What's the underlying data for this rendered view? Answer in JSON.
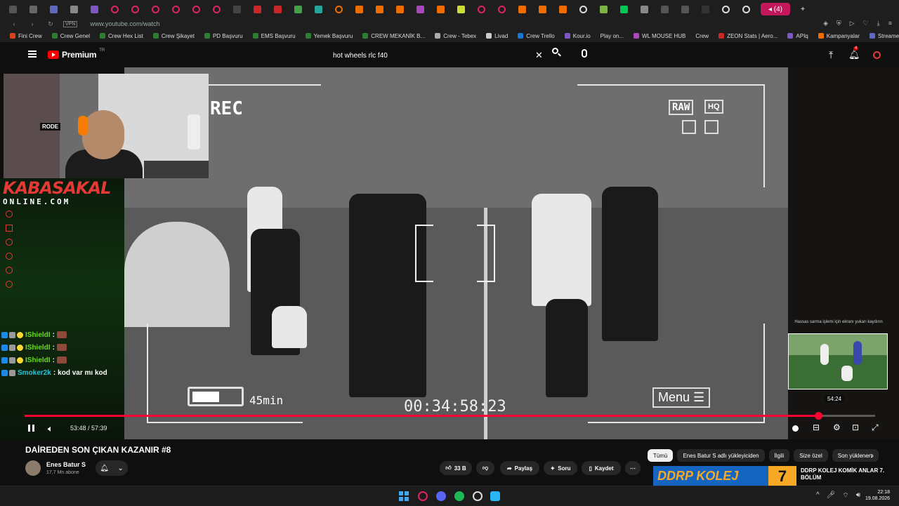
{
  "browser": {
    "active_tab_label": "◂ (4)",
    "url": "www.youtube.com/watch",
    "vpn_label": "VPN"
  },
  "bookmarks": [
    {
      "label": "Fini Crew"
    },
    {
      "label": "Crew Genel"
    },
    {
      "label": "Crew Hex List"
    },
    {
      "label": "Crew Şikayet"
    },
    {
      "label": "PD Başvuru"
    },
    {
      "label": "EMS Başvuru"
    },
    {
      "label": "Yemek Başvuru"
    },
    {
      "label": "CREW MEKANİK B..."
    },
    {
      "label": "Crew - Tebex"
    },
    {
      "label": "Livad"
    },
    {
      "label": "Crew Trello"
    },
    {
      "label": "Kour.io"
    },
    {
      "label": "Play on..."
    },
    {
      "label": "WL MOUSE HUB"
    },
    {
      "label": "Crew"
    },
    {
      "label": "ZEON Stats | Aero..."
    },
    {
      "label": "APIq"
    },
    {
      "label": "Kampanyalar"
    },
    {
      "label": "Streamer Panel"
    }
  ],
  "youtube": {
    "logo_text": "Premium",
    "logo_region": "TR",
    "search_query": "hot wheels rlc f40",
    "notification_count": "4"
  },
  "video_overlay": {
    "rec": "REC",
    "raw": "RAW",
    "hq": "HQ",
    "battery_min": "45min",
    "timecode": "00:34:58:23",
    "menu": "Menu"
  },
  "stream_overlay": {
    "brand": "KABASAKAL",
    "brand_sub": "ONLINE.COM",
    "mic_label": "RODE"
  },
  "chat": [
    {
      "user": "IShieldI",
      "message": ""
    },
    {
      "user": "IShieldI",
      "message": ""
    },
    {
      "user": "IShieldI",
      "message": ""
    },
    {
      "user": "Smoker2k",
      "message": "kod var mı kod"
    }
  ],
  "player": {
    "current_time": "53:48",
    "duration": "57:39",
    "time_text": "53:48 / 57:39",
    "preview_note": "Hassas sarma işlemi için ekranı yukarı kaydırın",
    "preview_time": "54:24",
    "progress_fraction": 0.933
  },
  "video_info": {
    "title": "DAİREDEN SON ÇIKAN KAZANIR #8",
    "channel": "Enes Batur S",
    "subscribers": "17,7 Mn abone",
    "likes": "33 B",
    "share": "Paylaş",
    "ask": "Soru",
    "save": "Kaydet"
  },
  "chips": [
    "Tümü",
    "Enes Batur S adlı yükleyiciden",
    "İlgili",
    "Size özel",
    "Son yüklenen"
  ],
  "recommendation": {
    "thumb_text": "DDRP KOLEJ",
    "thumb_number": "7",
    "title": "DDRP KOLEJ KOMİK ANLAR 7. BÖLÜM"
  },
  "taskbar": {
    "time": "22:18",
    "date": "19.08.2026"
  },
  "colors": {
    "accent_red": "#ff0033",
    "chat_green": "#64dd17",
    "brand_red": "#e53935"
  }
}
